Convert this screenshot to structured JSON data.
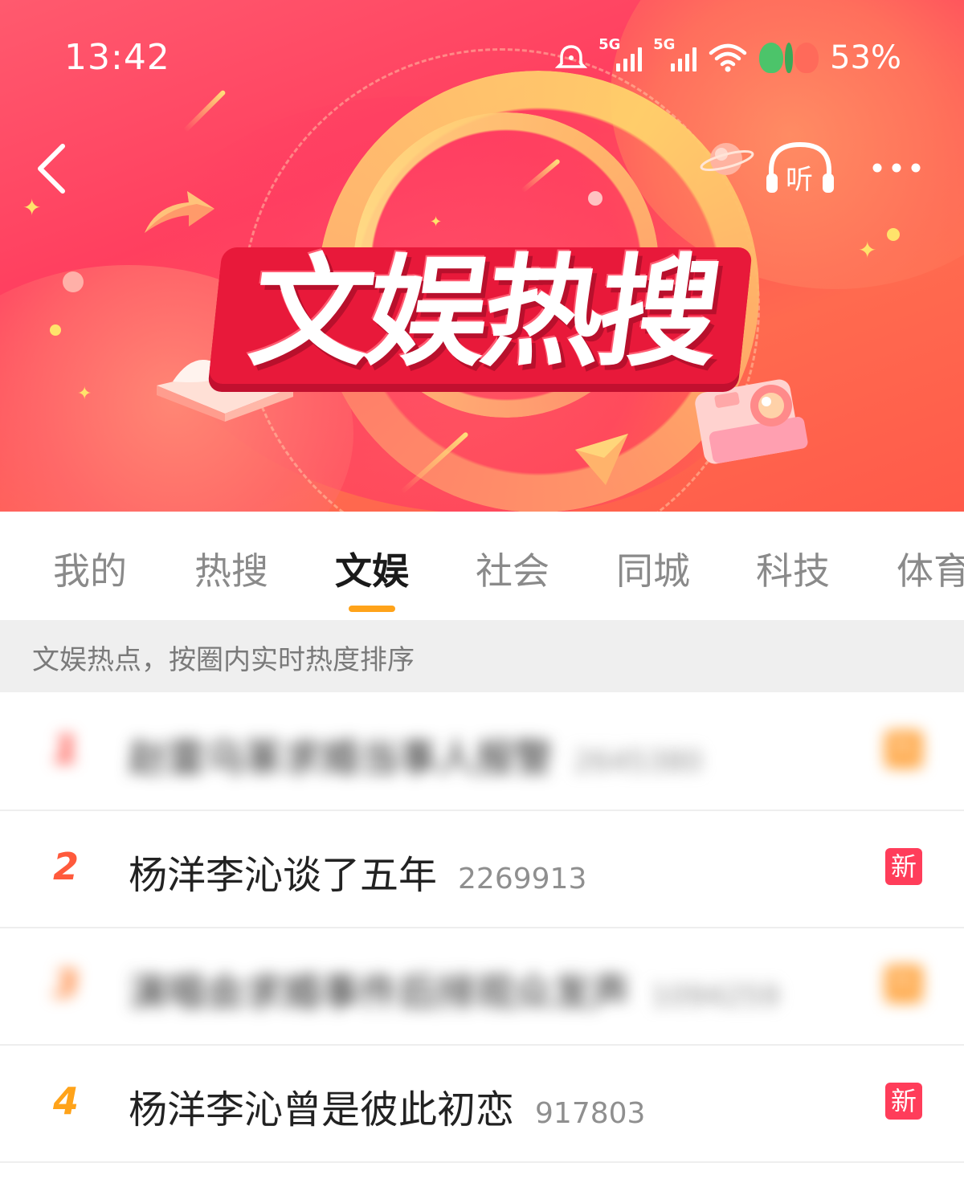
{
  "status_bar": {
    "time": "13:42",
    "signal_1_label": "5G",
    "signal_2_label": "5G",
    "battery": "53%",
    "icons": [
      "alarm-icon",
      "signal-icon",
      "signal-icon",
      "wifi-icon",
      "battery-leaf-icon"
    ]
  },
  "header": {
    "title": "文娱热搜",
    "listen_label": "听",
    "back_icon": "chevron-left-icon",
    "more_icon": "more-dots-icon"
  },
  "tabs": [
    {
      "label": "我的",
      "active": false
    },
    {
      "label": "热搜",
      "active": false
    },
    {
      "label": "文娱",
      "active": true
    },
    {
      "label": "社会",
      "active": false
    },
    {
      "label": "同城",
      "active": false
    },
    {
      "label": "科技",
      "active": false
    },
    {
      "label": "体育",
      "active": false
    }
  ],
  "info_strip": "文娱热点，按圈内实时热度排序",
  "colors": {
    "accent_underline": "#ffa31a",
    "badge_new": "#ff3d5a",
    "badge_hot": "#ff9a2a",
    "rank_1": "#ff3b30",
    "rank_2": "#ff5a3c",
    "rank_3": "#ff7a2a",
    "rank_4": "#ffa31a"
  },
  "list": [
    {
      "rank": "1",
      "title": "赵雷乌篆求婚当事人报警",
      "heat": "2645380",
      "badge": "热",
      "badge_type": "hot",
      "blurred": true
    },
    {
      "rank": "2",
      "title": "杨洋李沁谈了五年",
      "heat": "2269913",
      "badge": "新",
      "badge_type": "new",
      "blurred": false
    },
    {
      "rank": "3",
      "title": "演唱会求婚事件后排观众发声",
      "heat": "1094259",
      "badge": "热",
      "badge_type": "hot",
      "blurred": true
    },
    {
      "rank": "4",
      "title": "杨洋李沁曾是彼此初恋",
      "heat": "917803",
      "badge": "新",
      "badge_type": "new",
      "blurred": false
    }
  ]
}
